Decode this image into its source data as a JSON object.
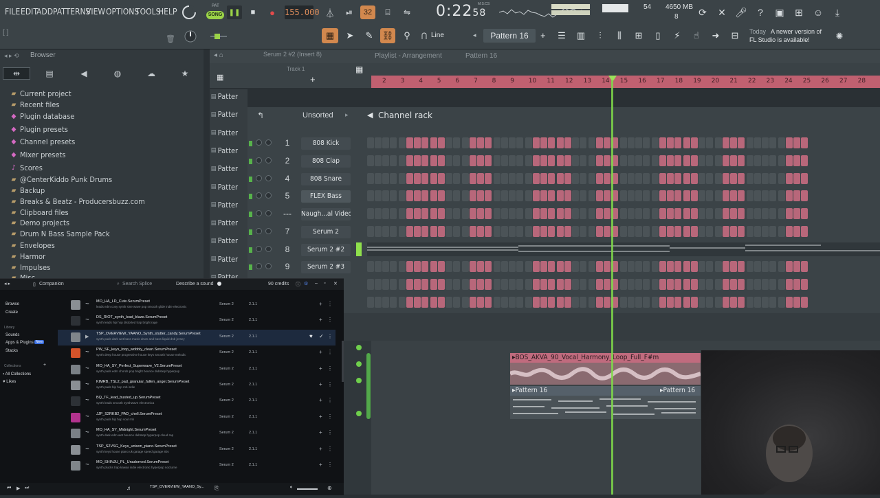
{
  "menu": [
    "FILE",
    "EDIT",
    "ADD",
    "PATTERNS",
    "VIEW",
    "OPTIONS",
    "TOOLS",
    "HELP"
  ],
  "transport": {
    "mode_pat": "PAT",
    "mode_song": "SONG",
    "tempo": "155.000",
    "time": "0:22",
    "time_frac": "58",
    "time_unit": "M:S:CS",
    "cpu": "54",
    "memory": "4650 MB",
    "polyphony": "8",
    "step": "32"
  },
  "toolbar": {
    "snap": "Line",
    "pattern": "Pattern 16",
    "news_line1": "Today",
    "news_line2": "A newer version of",
    "news_line3": "FL Studio is available!"
  },
  "browser": {
    "title": "Browser",
    "items": [
      {
        "label": "Current project",
        "icon": "folder-icon",
        "kind": "folder"
      },
      {
        "label": "Recent files",
        "icon": "folder-icon",
        "kind": "folder"
      },
      {
        "label": "Plugin database",
        "icon": "plugin-icon",
        "kind": "pink"
      },
      {
        "label": "Plugin presets",
        "icon": "plugin-icon",
        "kind": "pink"
      },
      {
        "label": "Channel presets",
        "icon": "plugin-icon",
        "kind": "pink"
      },
      {
        "label": "Mixer presets",
        "icon": "plugin-icon",
        "kind": "pink"
      },
      {
        "label": "Scores",
        "icon": "note-icon",
        "kind": "pink"
      },
      {
        "label": "@CenterKiddo Punk Drums",
        "icon": "folder-icon",
        "kind": "folder"
      },
      {
        "label": "Backup",
        "icon": "folder-icon",
        "kind": "folder"
      },
      {
        "label": "Breaks & Beatz - Producersbuzz.com",
        "icon": "folder-icon",
        "kind": "folder"
      },
      {
        "label": "Clipboard files",
        "icon": "folder-icon",
        "kind": "folder"
      },
      {
        "label": "Demo projects",
        "icon": "folder-icon",
        "kind": "folder"
      },
      {
        "label": "Drum N Bass Sample Pack",
        "icon": "folder-icon",
        "kind": "folder"
      },
      {
        "label": "Envelopes",
        "icon": "folder-icon",
        "kind": "folder"
      },
      {
        "label": "Harmor",
        "icon": "folder-icon",
        "kind": "folder"
      },
      {
        "label": "Impulses",
        "icon": "folder-icon",
        "kind": "folder"
      },
      {
        "label": "Misc",
        "icon": "folder-icon",
        "kind": "folder"
      }
    ]
  },
  "playlist": {
    "title": "Playlist - Arrangement",
    "pattern_title": "Pattern 16",
    "track_label": "Track 1",
    "pattern_tab": "Patter",
    "ruler": [
      "2",
      "3",
      "4",
      "5",
      "6",
      "7",
      "8",
      "9",
      "10",
      "11",
      "12",
      "13",
      "14",
      "15",
      "16",
      "17",
      "18",
      "19",
      "20",
      "21",
      "22",
      "23",
      "24",
      "25",
      "26",
      "27",
      "28"
    ],
    "audio_clip": "BOS_AKVA_90_Vocal_Harmony_Loop_Full_F#m",
    "pattern_clip_a": "Pattern 16",
    "pattern_clip_b": "Pattern 16",
    "breadcrumb": "Serum 2 #2 (Insert 8)"
  },
  "rack": {
    "title": "Channel rack",
    "filter": "Unsorted",
    "channels": [
      {
        "num": "1",
        "name": "808 Kick"
      },
      {
        "num": "2",
        "name": "808 Clap"
      },
      {
        "num": "4",
        "name": "808 Snare"
      },
      {
        "num": "5",
        "name": "FLEX Bass",
        "selected": true
      },
      {
        "num": "---",
        "name": "Naugh...al Video)"
      },
      {
        "num": "7",
        "name": "Serum 2"
      },
      {
        "num": "8",
        "name": "Serum 2 #2",
        "piano": true
      },
      {
        "num": "9",
        "name": "Serum 2 #3"
      }
    ]
  },
  "companion": {
    "title": "Companion",
    "search_placeholder": "Search Splice",
    "describe": "Describe a sound",
    "credits": "90 credits",
    "side": {
      "browse": "Browse",
      "create": "Create",
      "library": "Library",
      "sounds": "Sounds",
      "apps": "Apps & Plugins",
      "apps_badge": "New",
      "stacks": "Stacks",
      "collections": "Collections",
      "all": "All Collections",
      "likes": "Likes"
    },
    "presets": [
      {
        "name": "MO_HA_LD_Cute.SerumPreset",
        "tags": "leads   edm   cosy   synth   sine wave   pop   smooth   glide   indie electronic",
        "color": "#8a8f94"
      },
      {
        "name": "DS_RIOT_synth_lead_blaze.SerumPreset",
        "tags": "synth   leads   hip hop   distorted   trap   bright   rage",
        "color": "#2d3136"
      },
      {
        "name": "TSP_OVERVIEW_YAANO_Synth_stutter_candy.SerumPreset",
        "tags": "synth   pads   dark   wet   bass music   drum and bass   liquid dnb   jersey",
        "color": "#7f858a"
      },
      {
        "name": "PW_SF_keys_loop_wobbly_clean.SerumPreset",
        "tags": "synth   deep house   progressive house   keys   smooth   house   melodic",
        "color": "#d4532a"
      },
      {
        "name": "MO_HA_SY_Perfect_Superwave_V2.SerumPreset",
        "tags": "synth   pads   edm   chords   pop   bright   bounce dubstep   hyperpop",
        "color": "#7a8086"
      },
      {
        "name": "KIMRB_TSL2_pad_granular_fallen_angel.SerumPreset",
        "tags": "synth   pads   hip hop   rnb   indie",
        "color": "#8a8f94"
      },
      {
        "name": "BQ_TF_lead_busted_up.SerumPreset",
        "tags": "synth   leads   smooth   synthwave   electronica",
        "color": "#2d3136"
      },
      {
        "name": "JJP_S2RKB2_PAD_chell.SerumPreset",
        "tags": "synth   pads   hip hop   soul   rnb",
        "color": "#b2338e"
      },
      {
        "name": "MO_HA_SY_Midnight.SerumPreset",
        "tags": "synth   dark   edm   wet   bounce dubstep   hyperpop   cloud rap",
        "color": "#7a8086"
      },
      {
        "name": "TSP_S2VSG_Keys_unison_piano.SerumPreset",
        "tags": "synth   keys   house   piano   uk garage   speed garage   80s",
        "color": "#8a8f94"
      },
      {
        "name": "MO_SHINJU_PL_Unadorned.SerumPreset",
        "tags": "synth   plucks   trap   kawaii   indie electronic   hyperpop   nocturne",
        "color": "#7f858a"
      }
    ],
    "synth": "Serum 2",
    "version": "2.1.1",
    "now_playing": "TSP_OVERVIEW_YAANO_Sy..."
  }
}
